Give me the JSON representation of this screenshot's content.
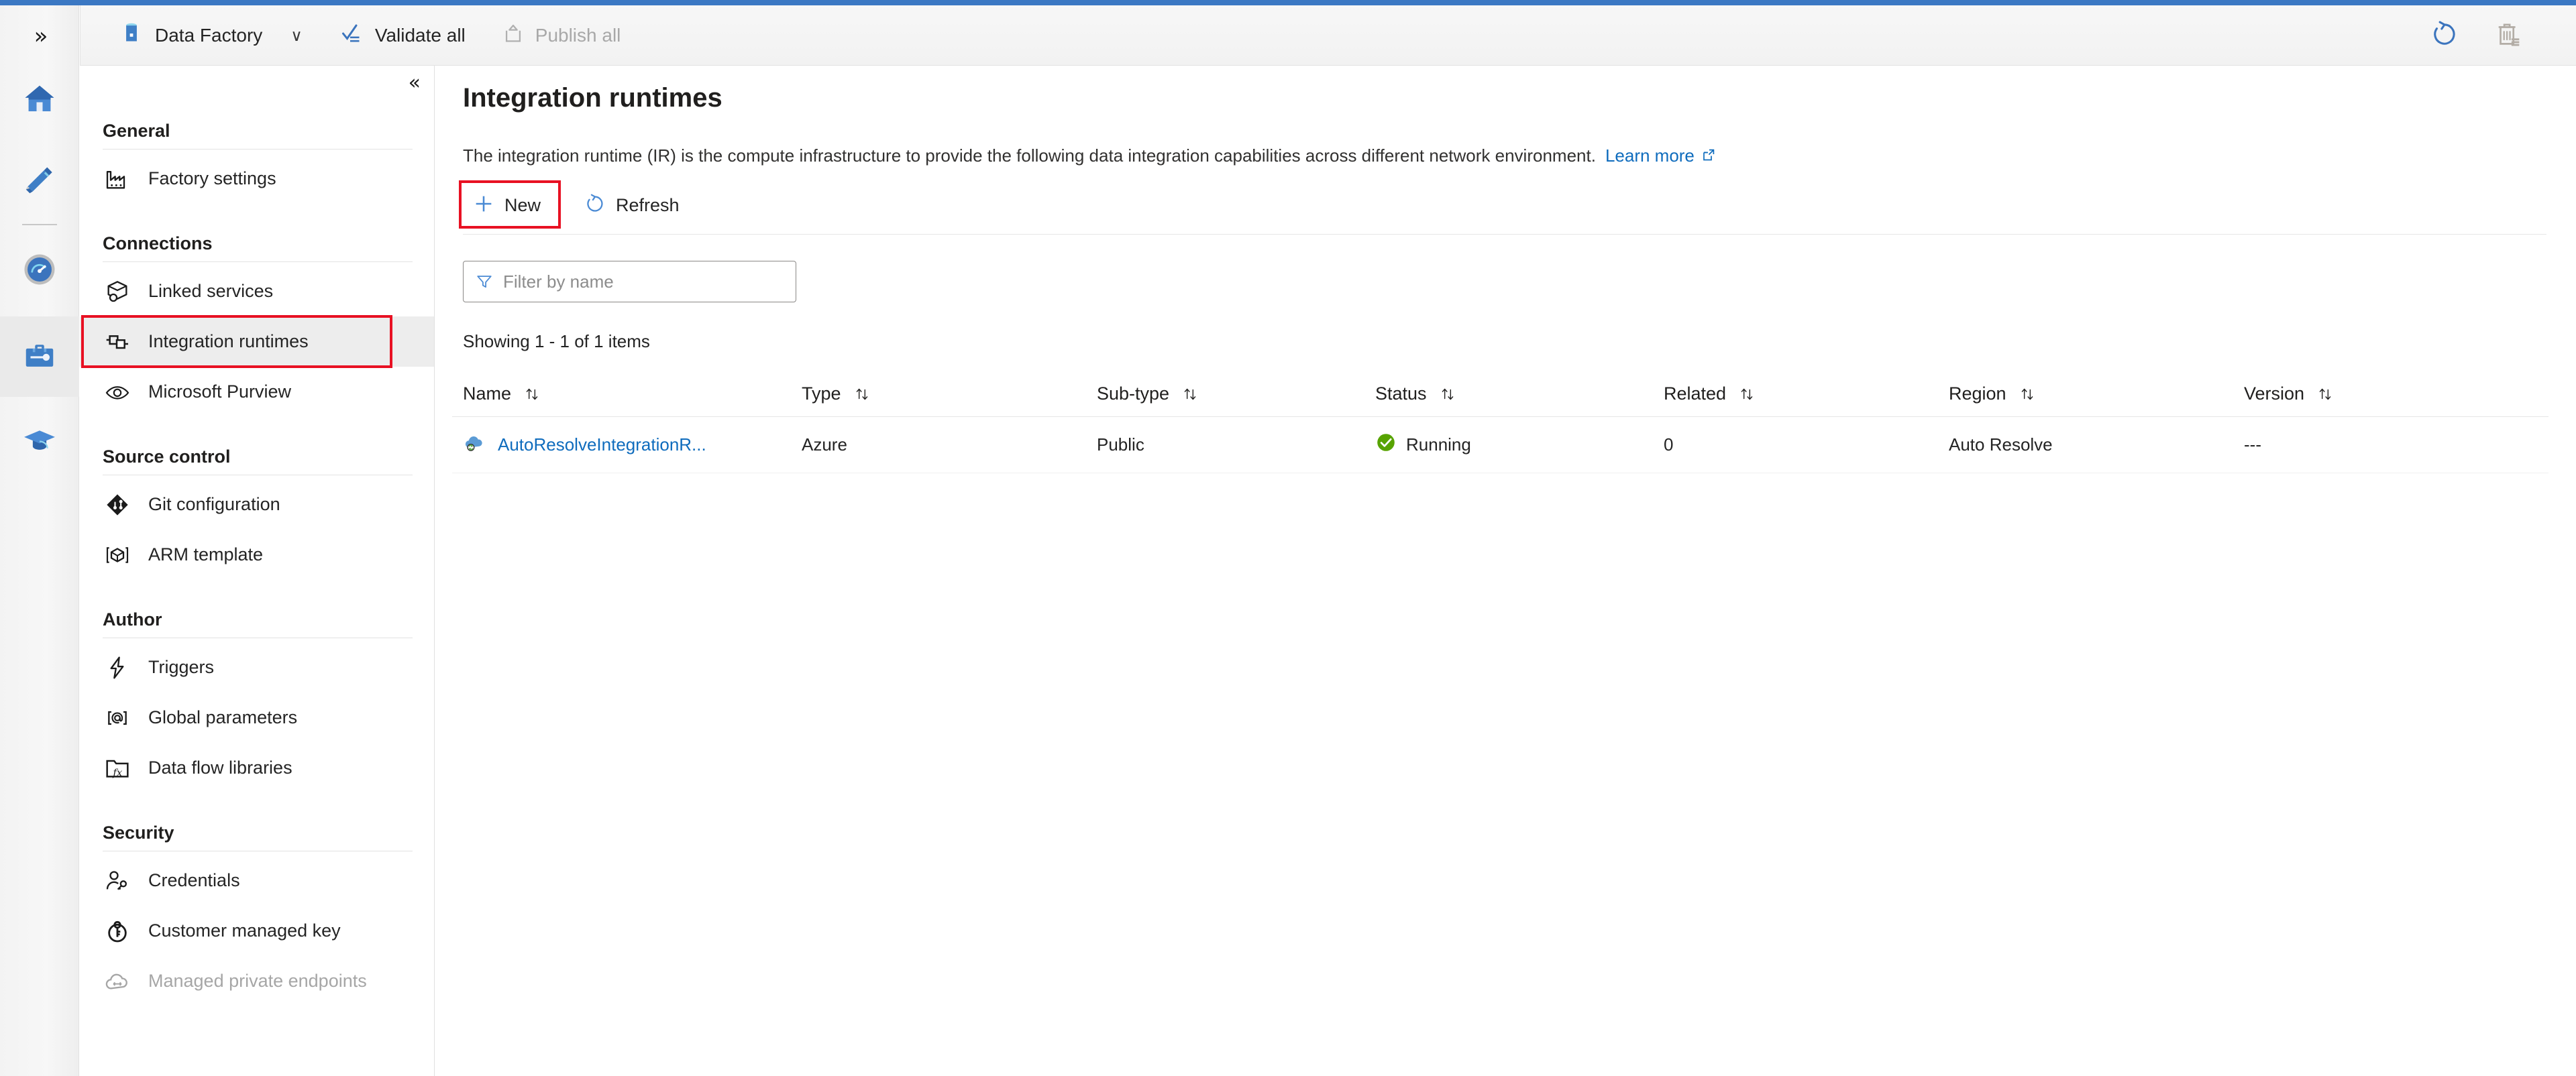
{
  "theme": {
    "accent_bar": "#3b78c3",
    "link": "#0f6cbd",
    "highlight_box": "#e81123",
    "status_running": "#57a300"
  },
  "command_bar": {
    "app_icon": "data-factory-icon",
    "app_title": "Data Factory",
    "chevron": "∨",
    "validate_all": "Validate all",
    "publish_all": "Publish all",
    "refresh_icon": "refresh-icon",
    "discard_icon": "discard-all-icon"
  },
  "rail": {
    "expand_glyph": "»",
    "items": [
      {
        "name": "home",
        "label": "Home"
      },
      {
        "name": "author",
        "label": "Author"
      },
      {
        "name": "monitor",
        "label": "Monitor"
      },
      {
        "name": "manage",
        "label": "Manage"
      },
      {
        "name": "learning-center",
        "label": "Learning center"
      }
    ]
  },
  "nav": {
    "collapse_glyph": "«",
    "groups": [
      {
        "title": "General",
        "items": [
          {
            "label": "Factory settings",
            "icon": "factory-icon",
            "selected": false,
            "disabled": false
          }
        ]
      },
      {
        "title": "Connections",
        "items": [
          {
            "label": "Linked services",
            "icon": "linked-services-icon",
            "selected": false,
            "disabled": false
          },
          {
            "label": "Integration runtimes",
            "icon": "integration-runtime-icon",
            "selected": true,
            "disabled": false
          },
          {
            "label": "Microsoft Purview",
            "icon": "purview-eye-icon",
            "selected": false,
            "disabled": false
          }
        ]
      },
      {
        "title": "Source control",
        "items": [
          {
            "label": "Git configuration",
            "icon": "git-icon",
            "selected": false,
            "disabled": false
          },
          {
            "label": "ARM template",
            "icon": "arm-template-icon",
            "selected": false,
            "disabled": false
          }
        ]
      },
      {
        "title": "Author",
        "items": [
          {
            "label": "Triggers",
            "icon": "lightning-icon",
            "selected": false,
            "disabled": false
          },
          {
            "label": "Global parameters",
            "icon": "at-brackets-icon",
            "selected": false,
            "disabled": false
          },
          {
            "label": "Data flow libraries",
            "icon": "folder-fx-icon",
            "selected": false,
            "disabled": false
          }
        ]
      },
      {
        "title": "Security",
        "items": [
          {
            "label": "Credentials",
            "icon": "person-key-icon",
            "selected": false,
            "disabled": false
          },
          {
            "label": "Customer managed key",
            "icon": "key-circle-icon",
            "selected": false,
            "disabled": false
          },
          {
            "label": "Managed private endpoints",
            "icon": "cloud-endpoint-icon",
            "selected": false,
            "disabled": true
          }
        ]
      }
    ]
  },
  "page": {
    "title": "Integration runtimes",
    "description": "The integration runtime (IR) is the compute infrastructure to provide the following data integration capabilities across different network environment.",
    "learn_more": "Learn more",
    "learn_more_icon": "external-link-icon"
  },
  "actions": {
    "new_label": "New",
    "new_icon": "plus-icon",
    "refresh_label": "Refresh",
    "refresh_icon": "refresh-icon"
  },
  "filter": {
    "placeholder": "Filter by name",
    "value": "",
    "icon": "funnel-icon"
  },
  "list": {
    "showing": "Showing 1 - 1 of 1 items",
    "columns": [
      {
        "key": "name",
        "label": "Name",
        "sortable": true
      },
      {
        "key": "type",
        "label": "Type",
        "sortable": true
      },
      {
        "key": "subtype",
        "label": "Sub-type",
        "sortable": true
      },
      {
        "key": "status",
        "label": "Status",
        "sortable": true
      },
      {
        "key": "related",
        "label": "Related",
        "sortable": true
      },
      {
        "key": "region",
        "label": "Region",
        "sortable": true
      },
      {
        "key": "version",
        "label": "Version",
        "sortable": true
      }
    ],
    "rows": [
      {
        "icon": "azure-ir-cloud-icon",
        "name": "AutoResolveIntegrationR...",
        "type": "Azure",
        "subtype": "Public",
        "status": "Running",
        "status_icon": "check-circle-icon",
        "related": "0",
        "region": "Auto Resolve",
        "version": "---"
      }
    ]
  }
}
